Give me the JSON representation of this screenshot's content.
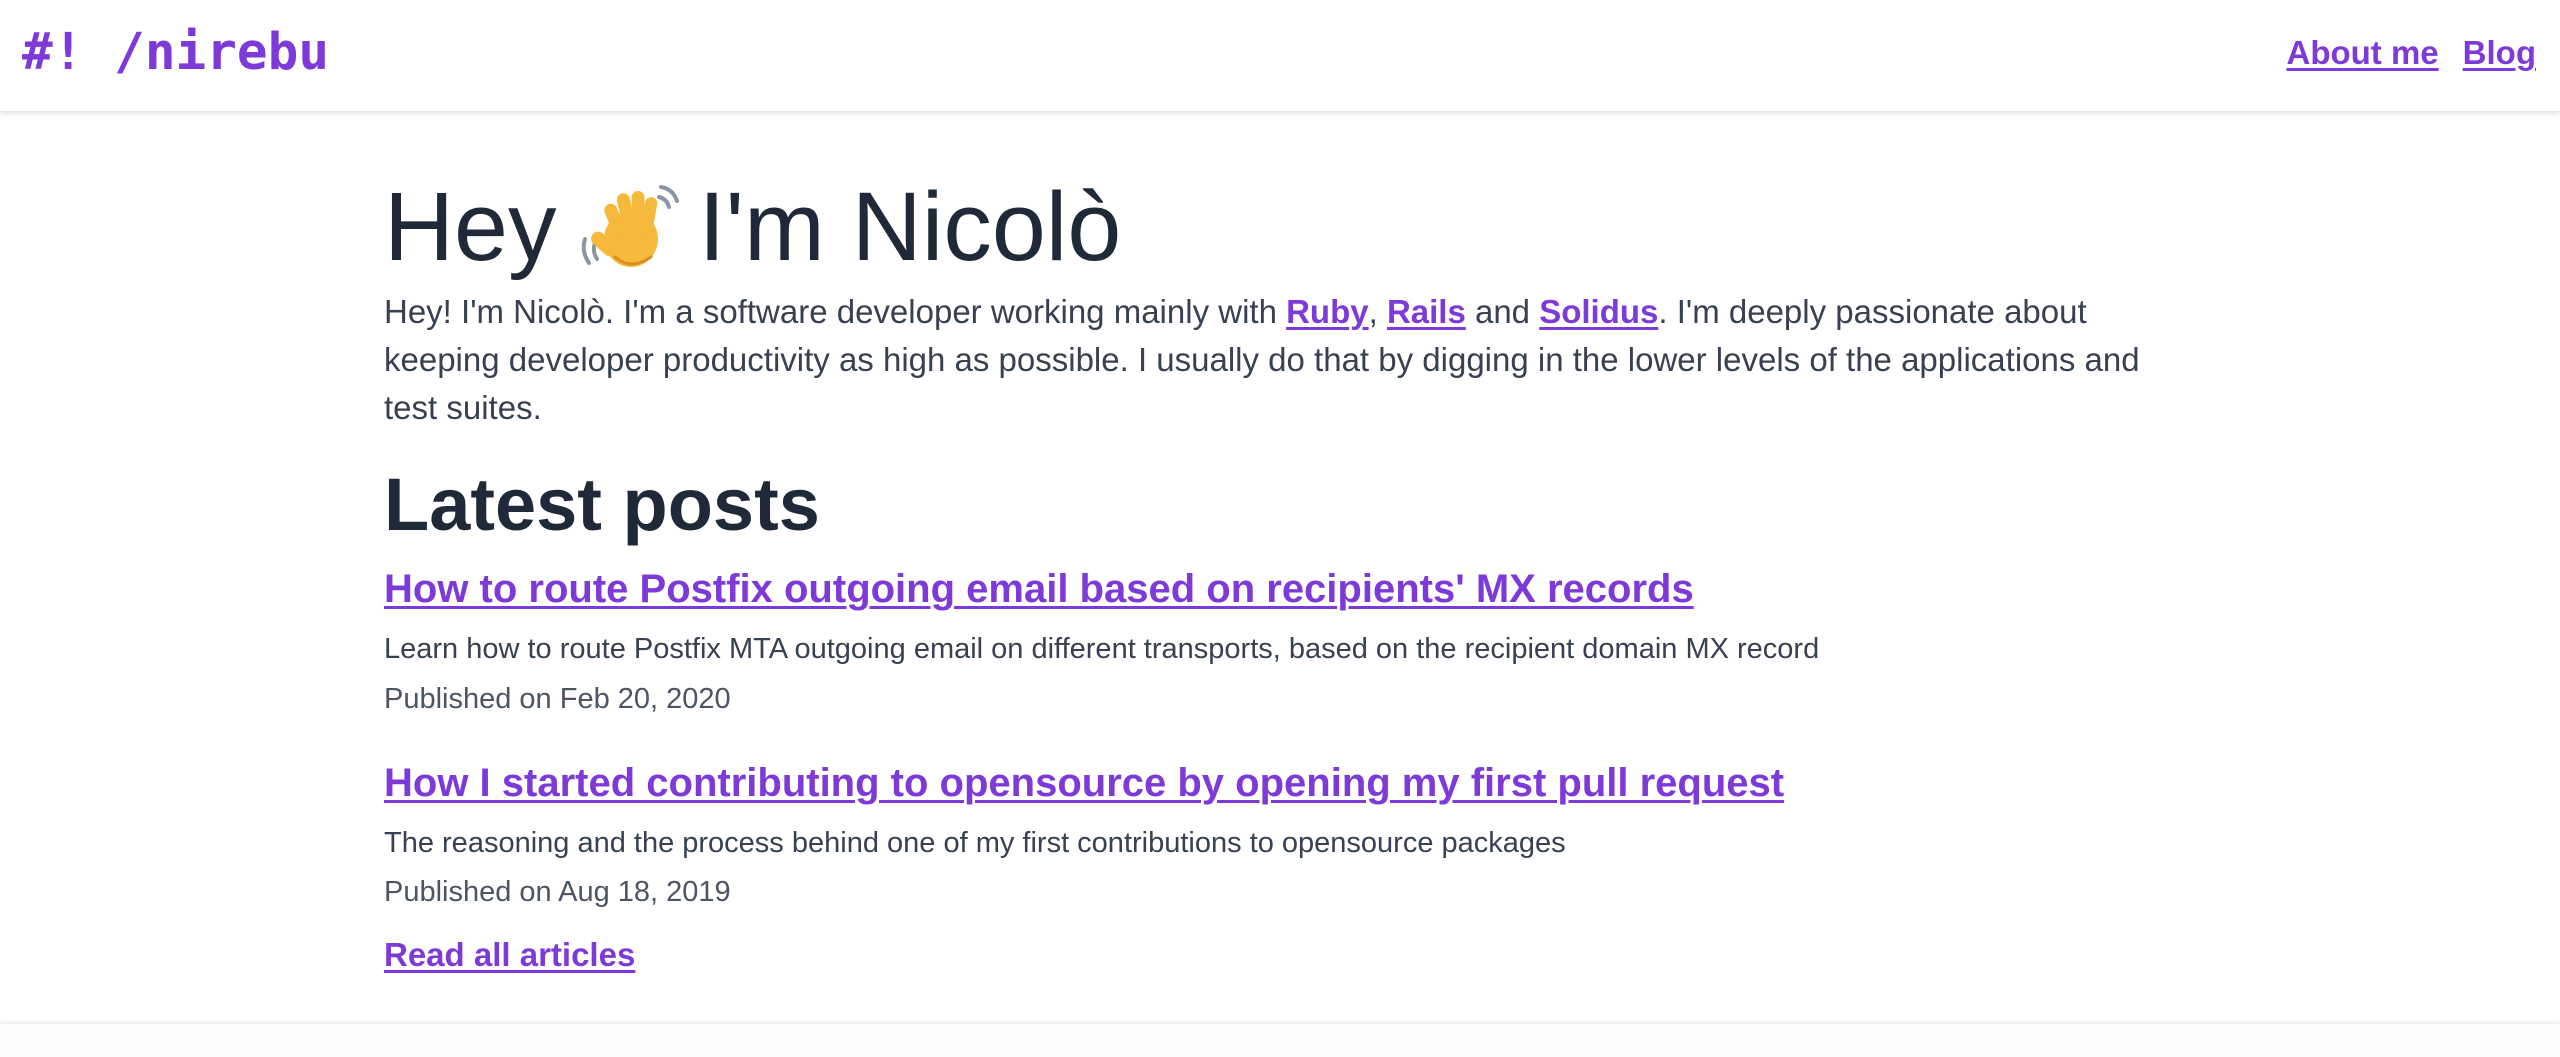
{
  "header": {
    "logo": "#! /nirebu",
    "nav": [
      {
        "label": "About me"
      },
      {
        "label": "Blog"
      }
    ]
  },
  "hero": {
    "greeting_before": "Hey",
    "greeting_after": "I'm Nicolò",
    "emoji_icon": "waving-hand-icon",
    "intro": {
      "text_1": "Hey! I'm Nicolò. I'm a software developer working mainly with ",
      "link_ruby": "Ruby",
      "sep_1": ", ",
      "link_rails": "Rails",
      "sep_2": " and ",
      "link_solidus": "Solidus",
      "text_2": ". I'm deeply passionate about keeping developer productivity as high as possible. I usually do that by digging in the lower levels of the applications and test suites."
    }
  },
  "posts_section": {
    "title": "Latest posts",
    "posts": [
      {
        "title": "How to route Postfix outgoing email based on recipients' MX records",
        "description": "Learn how to route Postfix MTA outgoing email on different transports, based on the recipient domain MX record",
        "date": "Published on Feb 20, 2020"
      },
      {
        "title": "How I started contributing to opensource by opening my first pull request",
        "description": "The reasoning and the process behind one of my first contributions to opensource packages",
        "date": "Published on Aug 18, 2019"
      }
    ],
    "read_all": "Read all articles"
  },
  "colors": {
    "accent": "#7e3ad8",
    "text": "#1f2937",
    "muted": "#374151"
  }
}
